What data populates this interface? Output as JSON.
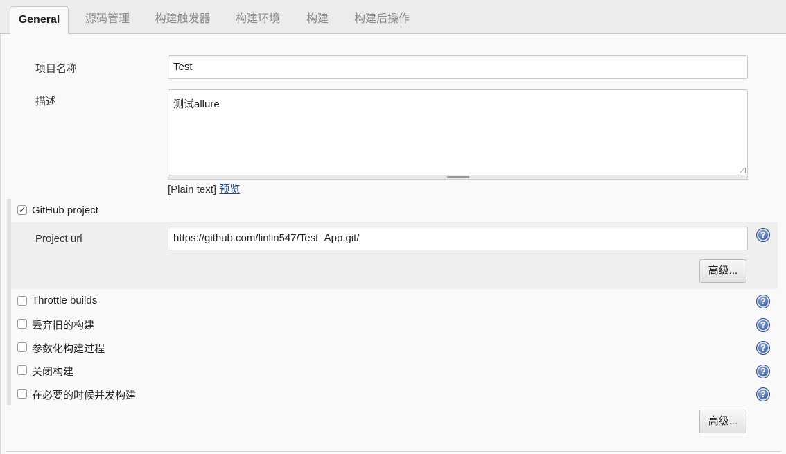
{
  "tabs": [
    {
      "label": "General",
      "active": true
    },
    {
      "label": "源码管理",
      "active": false
    },
    {
      "label": "构建触发器",
      "active": false
    },
    {
      "label": "构建环境",
      "active": false
    },
    {
      "label": "构建",
      "active": false
    },
    {
      "label": "构建后操作",
      "active": false
    }
  ],
  "form": {
    "project_name_label": "项目名称",
    "project_name_value": "Test",
    "description_label": "描述",
    "description_value": "测试allure",
    "description_format": "[Plain text]",
    "preview_link": "预览"
  },
  "github": {
    "label": "GitHub project",
    "checked": true,
    "url_label": "Project url",
    "url_value": "https://github.com/linlin547/Test_App.git/",
    "advanced_button": "高级..."
  },
  "options": [
    {
      "label": "Throttle builds",
      "checked": false
    },
    {
      "label": "丢弃旧的构建",
      "checked": false
    },
    {
      "label": "参数化构建过程",
      "checked": false
    },
    {
      "label": "关闭构建",
      "checked": false
    },
    {
      "label": "在必要的时候并发构建",
      "checked": false
    }
  ],
  "footer": {
    "advanced_button": "高级..."
  },
  "icons": {
    "help": "help-icon",
    "check": "✓"
  },
  "colors": {
    "link": "#204a87",
    "help_icon": "#3f5f9c"
  }
}
